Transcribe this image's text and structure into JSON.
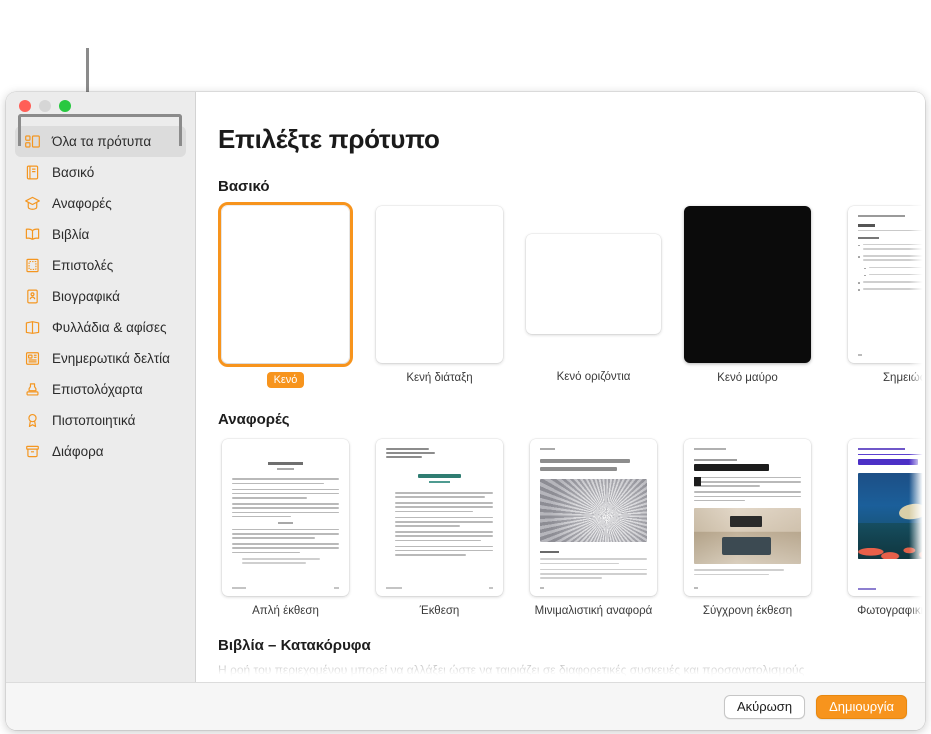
{
  "window": {
    "traffic_lights": [
      "close",
      "minimize",
      "zoom"
    ]
  },
  "sidebar": {
    "items": [
      {
        "label": "Όλα τα πρότυπα",
        "icon": "all-templates-icon",
        "active": true
      },
      {
        "label": "Βασικό",
        "icon": "basic-icon",
        "active": false
      },
      {
        "label": "Αναφορές",
        "icon": "reports-icon",
        "active": false
      },
      {
        "label": "Βιβλία",
        "icon": "books-icon",
        "active": false
      },
      {
        "label": "Επιστολές",
        "icon": "letters-icon",
        "active": false
      },
      {
        "label": "Βιογραφικά",
        "icon": "resumes-icon",
        "active": false
      },
      {
        "label": "Φυλλάδια & αφίσες",
        "icon": "flyers-posters-icon",
        "active": false
      },
      {
        "label": "Ενημερωτικά δελτία",
        "icon": "newsletters-icon",
        "active": false
      },
      {
        "label": "Επιστολόχαρτα",
        "icon": "stationery-icon",
        "active": false
      },
      {
        "label": "Πιστοποιητικά",
        "icon": "certificates-icon",
        "active": false
      },
      {
        "label": "Διάφορα",
        "icon": "miscellaneous-icon",
        "active": false
      }
    ]
  },
  "main": {
    "title": "Επιλέξτε πρότυπο",
    "sections": [
      {
        "heading": "Βασικό",
        "templates": [
          {
            "name": "Κενό",
            "style": "blank-portrait",
            "selected": true
          },
          {
            "name": "Κενή διάταξη",
            "style": "blank-portrait",
            "selected": false
          },
          {
            "name": "Κενό οριζόντια",
            "style": "blank-landscape",
            "selected": false
          },
          {
            "name": "Κενό μαύρο",
            "style": "blank-black",
            "selected": false
          },
          {
            "name": "Σημειώσεις",
            "style": "notes",
            "selected": false
          }
        ]
      },
      {
        "heading": "Αναφορές",
        "templates": [
          {
            "name": "Απλή έκθεση",
            "style": "simple-report",
            "selected": false
          },
          {
            "name": "Έκθεση",
            "style": "essay-report",
            "selected": false
          },
          {
            "name": "Μινιμαλιστική αναφορά",
            "style": "minimal-report",
            "selected": false
          },
          {
            "name": "Σύγχρονη έκθεση",
            "style": "modern-report",
            "selected": false
          },
          {
            "name": "Φωτογραφική έκθεση",
            "style": "photo-report",
            "selected": false
          }
        ]
      }
    ],
    "next_section": {
      "heading": "Βιβλία – Κατακόρυφα",
      "body": "Η ροή του περιεχομένου μπορεί να αλλάξει ώστε να ταιριάζει σε διαφορετικές συσκευές και προσανατολισμούς"
    }
  },
  "footer": {
    "cancel_label": "Ακύρωση",
    "create_label": "Δημιουργία"
  },
  "colors": {
    "accent": "#f7941d",
    "sidebar_bg": "#ececec",
    "selection": "#dcdcdc",
    "callout": "#8b8b8b"
  }
}
